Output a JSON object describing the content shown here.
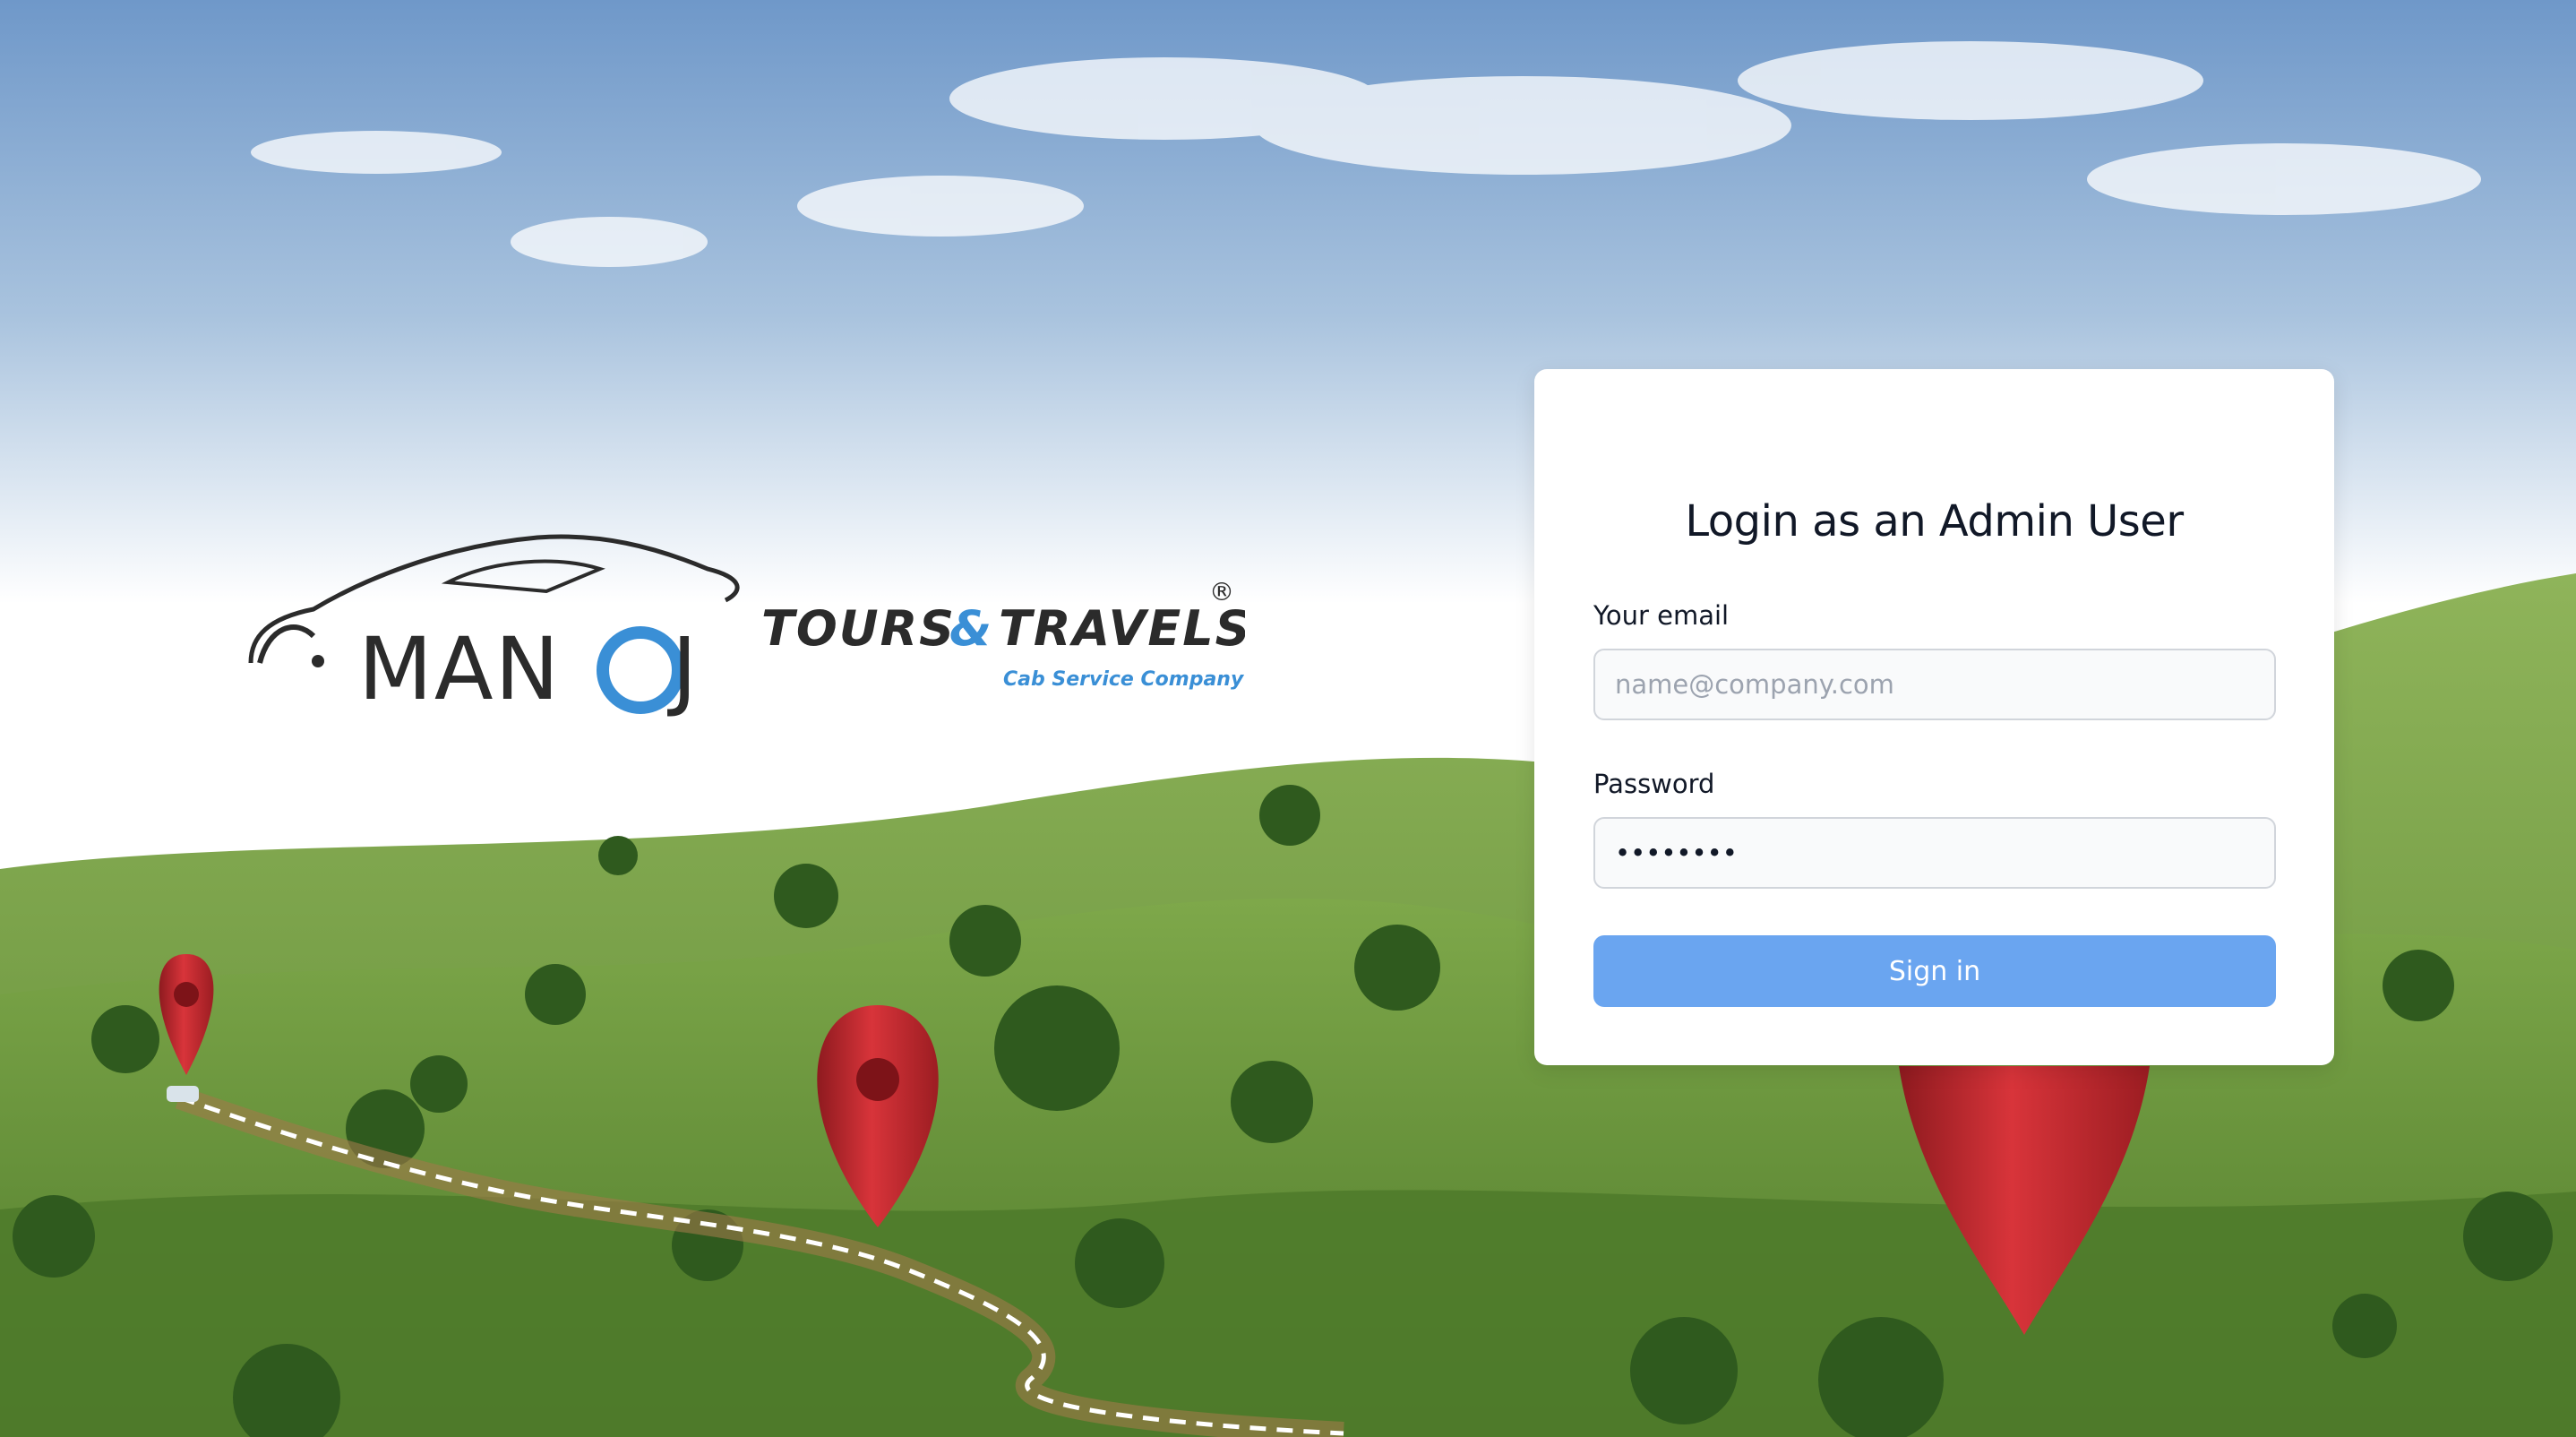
{
  "page": {
    "colors": {
      "sky_top": "#6f98c9",
      "grass": "#6d9a3e",
      "pin": "#c0272d",
      "accent": "#6aa5f0",
      "logo_blue": "#3a8fd6"
    }
  },
  "logo": {
    "name_left": "MAN",
    "name_o": "O",
    "name_right": "J",
    "tours": "TOURS",
    "amp": "&",
    "travels": "TRAVELS",
    "registered": "®",
    "tagline": "Cab Service Company"
  },
  "login": {
    "title": "Login as an Admin User",
    "email_label": "Your email",
    "email_placeholder": "name@company.com",
    "email_value": "",
    "password_label": "Password",
    "password_value": "••••••••",
    "submit_label": "Sign in"
  }
}
